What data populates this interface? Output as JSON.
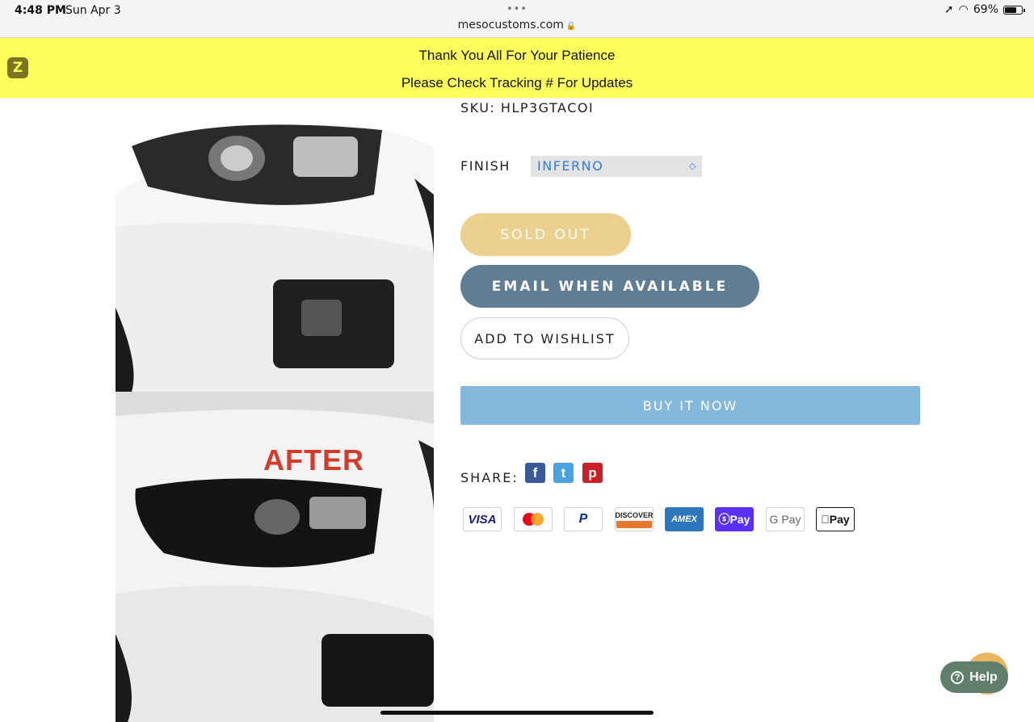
{
  "status_bar": {
    "time": "4:48 PM",
    "date": "Sun Apr 3",
    "url": "mesocustoms.com",
    "battery": "69%"
  },
  "announcement": {
    "line1": "Thank You All For Your Patience",
    "line2": "Please Check Tracking # For Updates"
  },
  "product": {
    "image_label": "AFTER",
    "sku": "SKU: HLP3GTACOI",
    "finish_label": "FINISH",
    "finish_value": "INFERNO"
  },
  "buttons": {
    "sold_out": "SOLD OUT",
    "email_when_available": "EMAIL WHEN AVAILABLE",
    "add_to_wishlist": "ADD TO WISHLIST",
    "buy_it_now": "BUY IT NOW"
  },
  "share": {
    "label": "SHARE:",
    "icons": [
      "facebook-icon",
      "twitter-icon",
      "pinterest-icon"
    ]
  },
  "payments": {
    "visa": "VISA",
    "paypal": "P",
    "discover": "DISCOVER",
    "amex": "AMEX",
    "shop_pay": "Pay",
    "google_pay": "G Pay",
    "apple_pay": "Pay"
  },
  "help": {
    "label": "Help"
  },
  "colors": {
    "announcement_bg": "#fdfd5c",
    "sold_out_bg": "#ecd08e",
    "email_bg": "#5f7e94",
    "buy_now_bg": "#85b8dd",
    "finish_text": "#2f7de1"
  }
}
